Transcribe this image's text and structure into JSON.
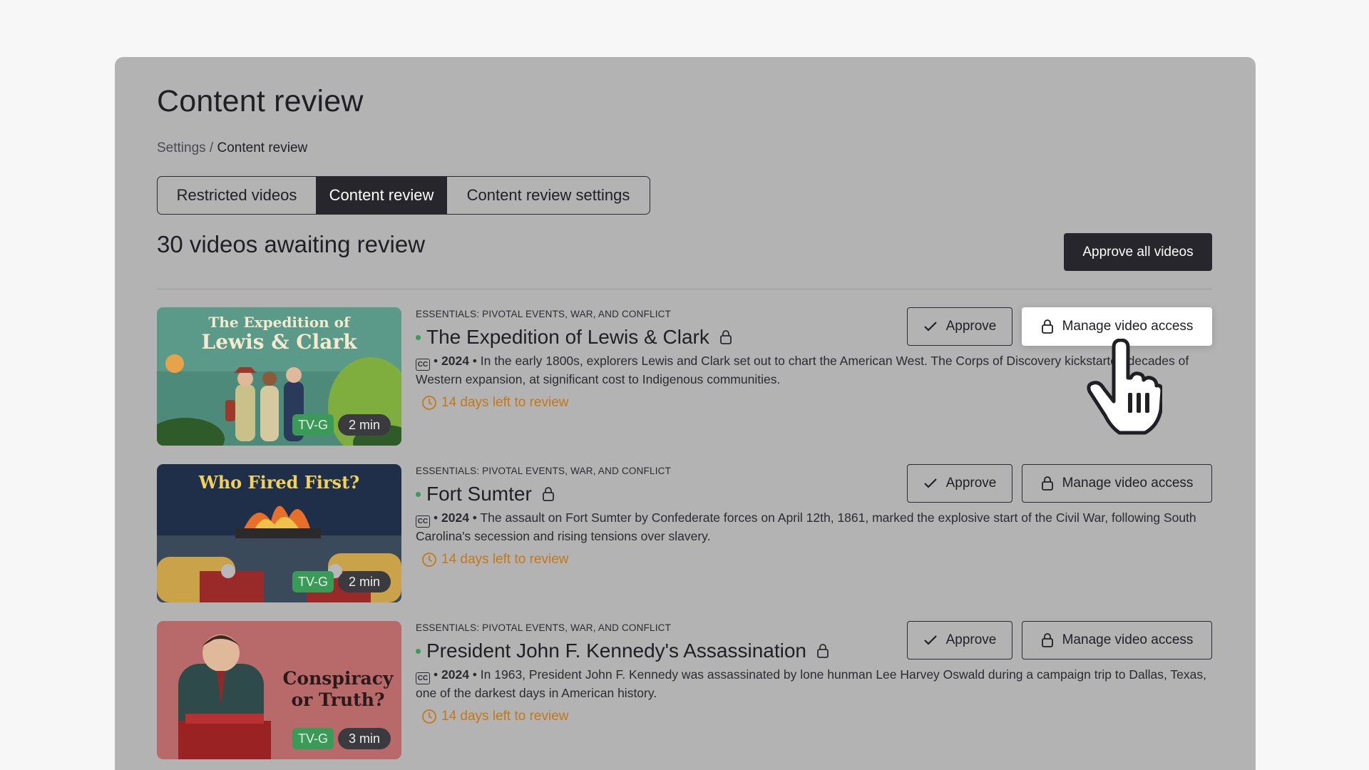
{
  "page": {
    "title": "Content review",
    "breadcrumb": {
      "parent": "Settings",
      "separator": " / ",
      "current": "Content review"
    },
    "tabs": [
      {
        "label": "Restricted videos",
        "active": false
      },
      {
        "label": "Content review",
        "active": true
      },
      {
        "label": "Content review settings",
        "active": false
      }
    ],
    "count_heading": "30 videos awaiting review",
    "approve_all_label": "Approve all videos"
  },
  "videos": [
    {
      "thumb_title_line1": "The Expedition of",
      "thumb_title_line2": "Lewis & Clark",
      "collection": "ESSENTIALS: PIVOTAL EVENTS, WAR, AND CONFLICT",
      "title": "The Expedition of Lewis & Clark",
      "cc": "CC",
      "year": "2024",
      "description": "In the early 1800s, explorers Lewis and Clark set out to chart the American West. The Corps of Discovery kickstarted decades of Western expansion, at significant cost to Indigenous communities.",
      "deadline": "14 days left to review",
      "rating": "TV-G",
      "duration": "2 min",
      "approve_label": "Approve",
      "manage_label": "Manage video access"
    },
    {
      "thumb_title_line1": "Who Fired First?",
      "collection": "ESSENTIALS: PIVOTAL EVENTS, WAR, AND CONFLICT",
      "title": "Fort Sumter",
      "cc": "CC",
      "year": "2024",
      "description": "The assault on Fort Sumter by Confederate forces on April 12th, 1861, marked the explosive start of the Civil War, following South Carolina's secession and rising tensions over slavery.",
      "deadline": "14 days left to review",
      "rating": "TV-G",
      "duration": "2 min",
      "approve_label": "Approve",
      "manage_label": "Manage video access"
    },
    {
      "thumb_title_line1": "Conspiracy",
      "thumb_title_line2": "or Truth?",
      "collection": "ESSENTIALS: PIVOTAL EVENTS, WAR, AND CONFLICT",
      "title": "President John F. Kennedy's Assassination",
      "cc": "CC",
      "year": "2024",
      "description": "In 1963, President John F. Kennedy was assassinated by lone hunman Lee Harvey Oswald during a campaign trip to Dallas, Texas, one of the darkest days in American history.",
      "deadline": "14 days left to review",
      "rating": "TV-G",
      "duration": "3 min",
      "approve_label": "Approve",
      "manage_label": "Manage video access"
    }
  ],
  "colors": {
    "panel_bg": "#b3b3b3",
    "dark_button": "#26262c",
    "deadline": "#c3781a",
    "rating_badge": "#3a9a58"
  }
}
